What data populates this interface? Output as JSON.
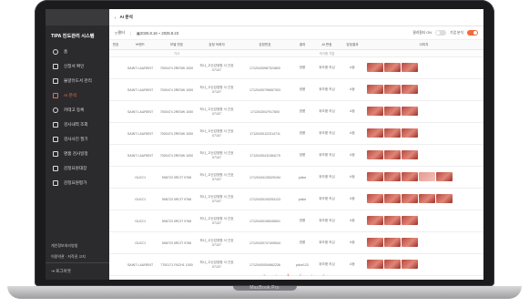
{
  "topbar": {
    "back_icon": "back-arrow-icon",
    "title": "AI 분석"
  },
  "sidebar": {
    "title": "TIPA 진도관리 시스템",
    "items": [
      {
        "label": "홈",
        "icon": "home-icon"
      },
      {
        "label": "신청서 확인",
        "icon": "doc-icon"
      },
      {
        "label": "불량유도서 관리",
        "icon": "list-icon"
      },
      {
        "label": "AI 분석",
        "icon": "chart-icon"
      },
      {
        "label": "카테고 등록",
        "icon": "tag-icon"
      },
      {
        "label": "검사내역 조회",
        "icon": "search-icon"
      },
      {
        "label": "검사사진 필기",
        "icon": "camera-icon"
      },
      {
        "label": "명품 검사일정",
        "icon": "calendar-icon"
      },
      {
        "label": "감정요원대장",
        "icon": "people-icon"
      },
      {
        "label": "감정요원평가",
        "icon": "person-icon"
      }
    ],
    "footer": {
      "line1": "개인정보처리방침",
      "line2": "이용약관 · 저작권 고지",
      "logout": "로그아웃"
    }
  },
  "filter": {
    "label": "필터",
    "date_range": "2025.8.16 ~ 2025.8.23",
    "toggle1": "결과필터 ON",
    "toggle2": "기업 분석"
  },
  "table": {
    "headers": [
      "번호",
      "브랜드",
      "모델 번호",
      "감정 의뢰자",
      "감정번호",
      "결과",
      "AI 판정",
      "감정결과",
      "이미지"
    ],
    "subhead": [
      "",
      "",
      "기사",
      "",
      "",
      "",
      "의기증 기업",
      "",
      ""
    ],
    "rows": [
      {
        "brand": "SAINT LAURENT",
        "model": "7000474 2RE0W 1000",
        "client": "하나_고산감정원 서 간호 07107",
        "id": "17120430987324800",
        "result": "양품",
        "ai": "위조품 의심",
        "grade": "A등",
        "thumbs": 3
      },
      {
        "brand": "SAINT LAURENT",
        "model": "7000474 2RE0W 1000",
        "client": "하나_고산감정원 서 간호 07107",
        "id": "17120430795657303",
        "result": "양품",
        "ai": "위조품 의심",
        "grade": "A등",
        "thumbs": 3
      },
      {
        "brand": "SAINT LAURENT",
        "model": "7000474 2RE0W 1000",
        "client": "하나_고산감정원 서 간호 07107",
        "id": "1712043047917800",
        "result": "양품",
        "ai": "위조품 의심",
        "grade": "A등",
        "thumbs": 3
      },
      {
        "brand": "SAINT LAURENT",
        "model": "7000474 2RE0W 1000",
        "client": "하나_고산감정원 서 간호 07107",
        "id": "17120430122314711",
        "result": "양품",
        "ai": "위조품 의심",
        "grade": "A등",
        "thumbs": 3
      },
      {
        "brand": "SAINT LAURENT",
        "model": "7000474 2RE0W 1000",
        "client": "하나_고산감정원 서 간호 07107",
        "id": "17120430411084179",
        "result": "양품",
        "ai": "위조품 의심",
        "grade": "A등",
        "thumbs": 3
      },
      {
        "brand": "GUCCI",
        "model": "598723 0RCIT 9768",
        "client": "하나_고산감정원 서 간호 07107",
        "id": "17120434128325154",
        "result": "pdice",
        "ai": "위조품 의심",
        "grade": "A등",
        "thumbs": 5
      },
      {
        "brand": "GUCCI",
        "model": "598723 0RCIT 9768",
        "client": "하나_고산감정원 서 간호 07107",
        "id": "17120430193253123",
        "result": "pdice",
        "ai": "위조품 의심",
        "grade": "A등",
        "thumbs": 5
      },
      {
        "brand": "GUCCI",
        "model": "598723 0RCIT 9768",
        "client": "하나_고산감정원 서 간호 07107",
        "id": "17120430198345501",
        "result": "양품",
        "ai": "위조품 의심",
        "grade": "A등",
        "thumbs": 3
      },
      {
        "brand": "GUCCI",
        "model": "598723 0RCIT 9768",
        "client": "하나_고산감정원 서 간호 07107",
        "id": "17120430747409544",
        "result": "양품",
        "ai": "위조품 의심",
        "grade": "A등",
        "thumbs": 3
      },
      {
        "brand": "SAINT LAURENT",
        "model": "7700171 FACH1 1000",
        "client": "하나_고산감정원 서 간호 07107",
        "id": "17120400054662236",
        "result": "pdce123",
        "ai": "위조품 의심",
        "grade": "A등",
        "thumbs": 3
      }
    ]
  },
  "pager": {
    "first": "«",
    "prev": "‹",
    "page1": "1",
    "page2": "2",
    "next": "›",
    "last": "»"
  },
  "laptop": {
    "brand": "MacBook Pro"
  },
  "colors": {
    "accent": "#f26a3f",
    "sidebar": "#2b2b2e"
  }
}
